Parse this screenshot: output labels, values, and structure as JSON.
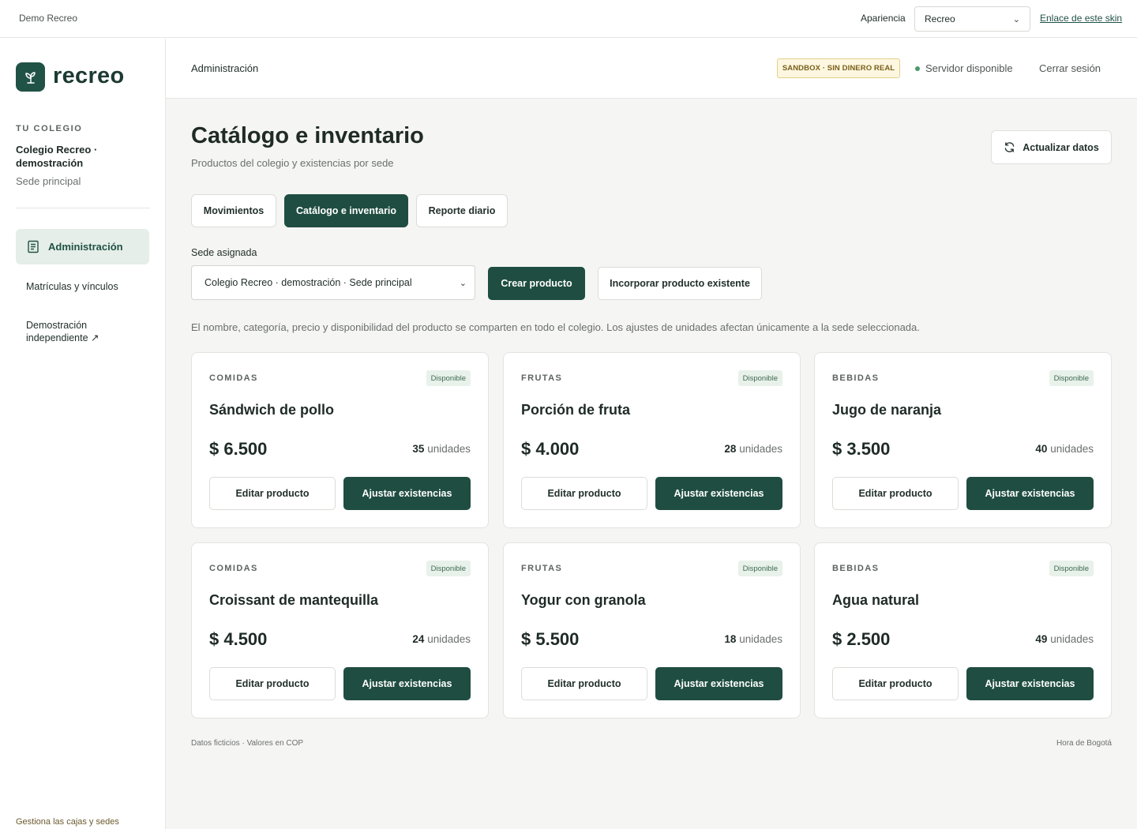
{
  "topbar": {
    "demo_label": "Demo Recreo",
    "appearance_label": "Apariencia",
    "skin_value": "Recreo",
    "skin_link": "Enlace de este skin"
  },
  "sidebar": {
    "logo_text": "recreo",
    "school_caption": "TU COLEGIO",
    "school_name": "Colegio Recreo · demostración",
    "school_site": "Sede principal",
    "nav": [
      {
        "label": "Administración",
        "active": true
      },
      {
        "label": "Matrículas y vínculos",
        "active": false
      },
      {
        "label": "Demostración independiente ↗",
        "active": false
      }
    ],
    "footer": "Gestiona las cajas y sedes"
  },
  "header": {
    "title": "Administración",
    "sandbox_badge": "SANDBOX · SIN DINERO REAL",
    "server_status": "Servidor disponible",
    "logout": "Cerrar sesión"
  },
  "main": {
    "title": "Catálogo e inventario",
    "subtitle": "Productos del colegio y existencias por sede",
    "refresh_label": "Actualizar datos",
    "tabs": [
      {
        "label": "Movimientos",
        "active": false
      },
      {
        "label": "Catálogo e inventario",
        "active": true
      },
      {
        "label": "Reporte diario",
        "active": false
      }
    ],
    "site_label": "Sede asignada",
    "site_value": "Colegio Recreo · demostración · Sede principal",
    "create_label": "Crear producto",
    "incorporate_label": "Incorporar producto existente",
    "info": "El nombre, categoría, precio y disponibilidad del producto se comparten en todo el colegio. Los ajustes de unidades afectan únicamente a la sede seleccionada.",
    "edit_label": "Editar producto",
    "adjust_label": "Ajustar existencias",
    "units_suffix": "unidades",
    "products": [
      {
        "category": "COMIDAS",
        "status": "Disponible",
        "name": "Sándwich de pollo",
        "price": "$ 6.500",
        "units": "35"
      },
      {
        "category": "FRUTAS",
        "status": "Disponible",
        "name": "Porción de fruta",
        "price": "$ 4.000",
        "units": "28"
      },
      {
        "category": "BEBIDAS",
        "status": "Disponible",
        "name": "Jugo de naranja",
        "price": "$ 3.500",
        "units": "40"
      },
      {
        "category": "COMIDAS",
        "status": "Disponible",
        "name": "Croissant de mantequilla",
        "price": "$ 4.500",
        "units": "24"
      },
      {
        "category": "FRUTAS",
        "status": "Disponible",
        "name": "Yogur con granola",
        "price": "$ 5.500",
        "units": "18"
      },
      {
        "category": "BEBIDAS",
        "status": "Disponible",
        "name": "Agua natural",
        "price": "$ 2.500",
        "units": "49"
      }
    ],
    "footer_left": "Datos ficticios · Valores en COP",
    "footer_right": "Hora de Bogotá"
  },
  "colors": {
    "brand": "#1f4d41",
    "accent_light": "#e5eee8",
    "status_green": "#4a9a68",
    "sandbox_bg": "#fdf7e1"
  }
}
